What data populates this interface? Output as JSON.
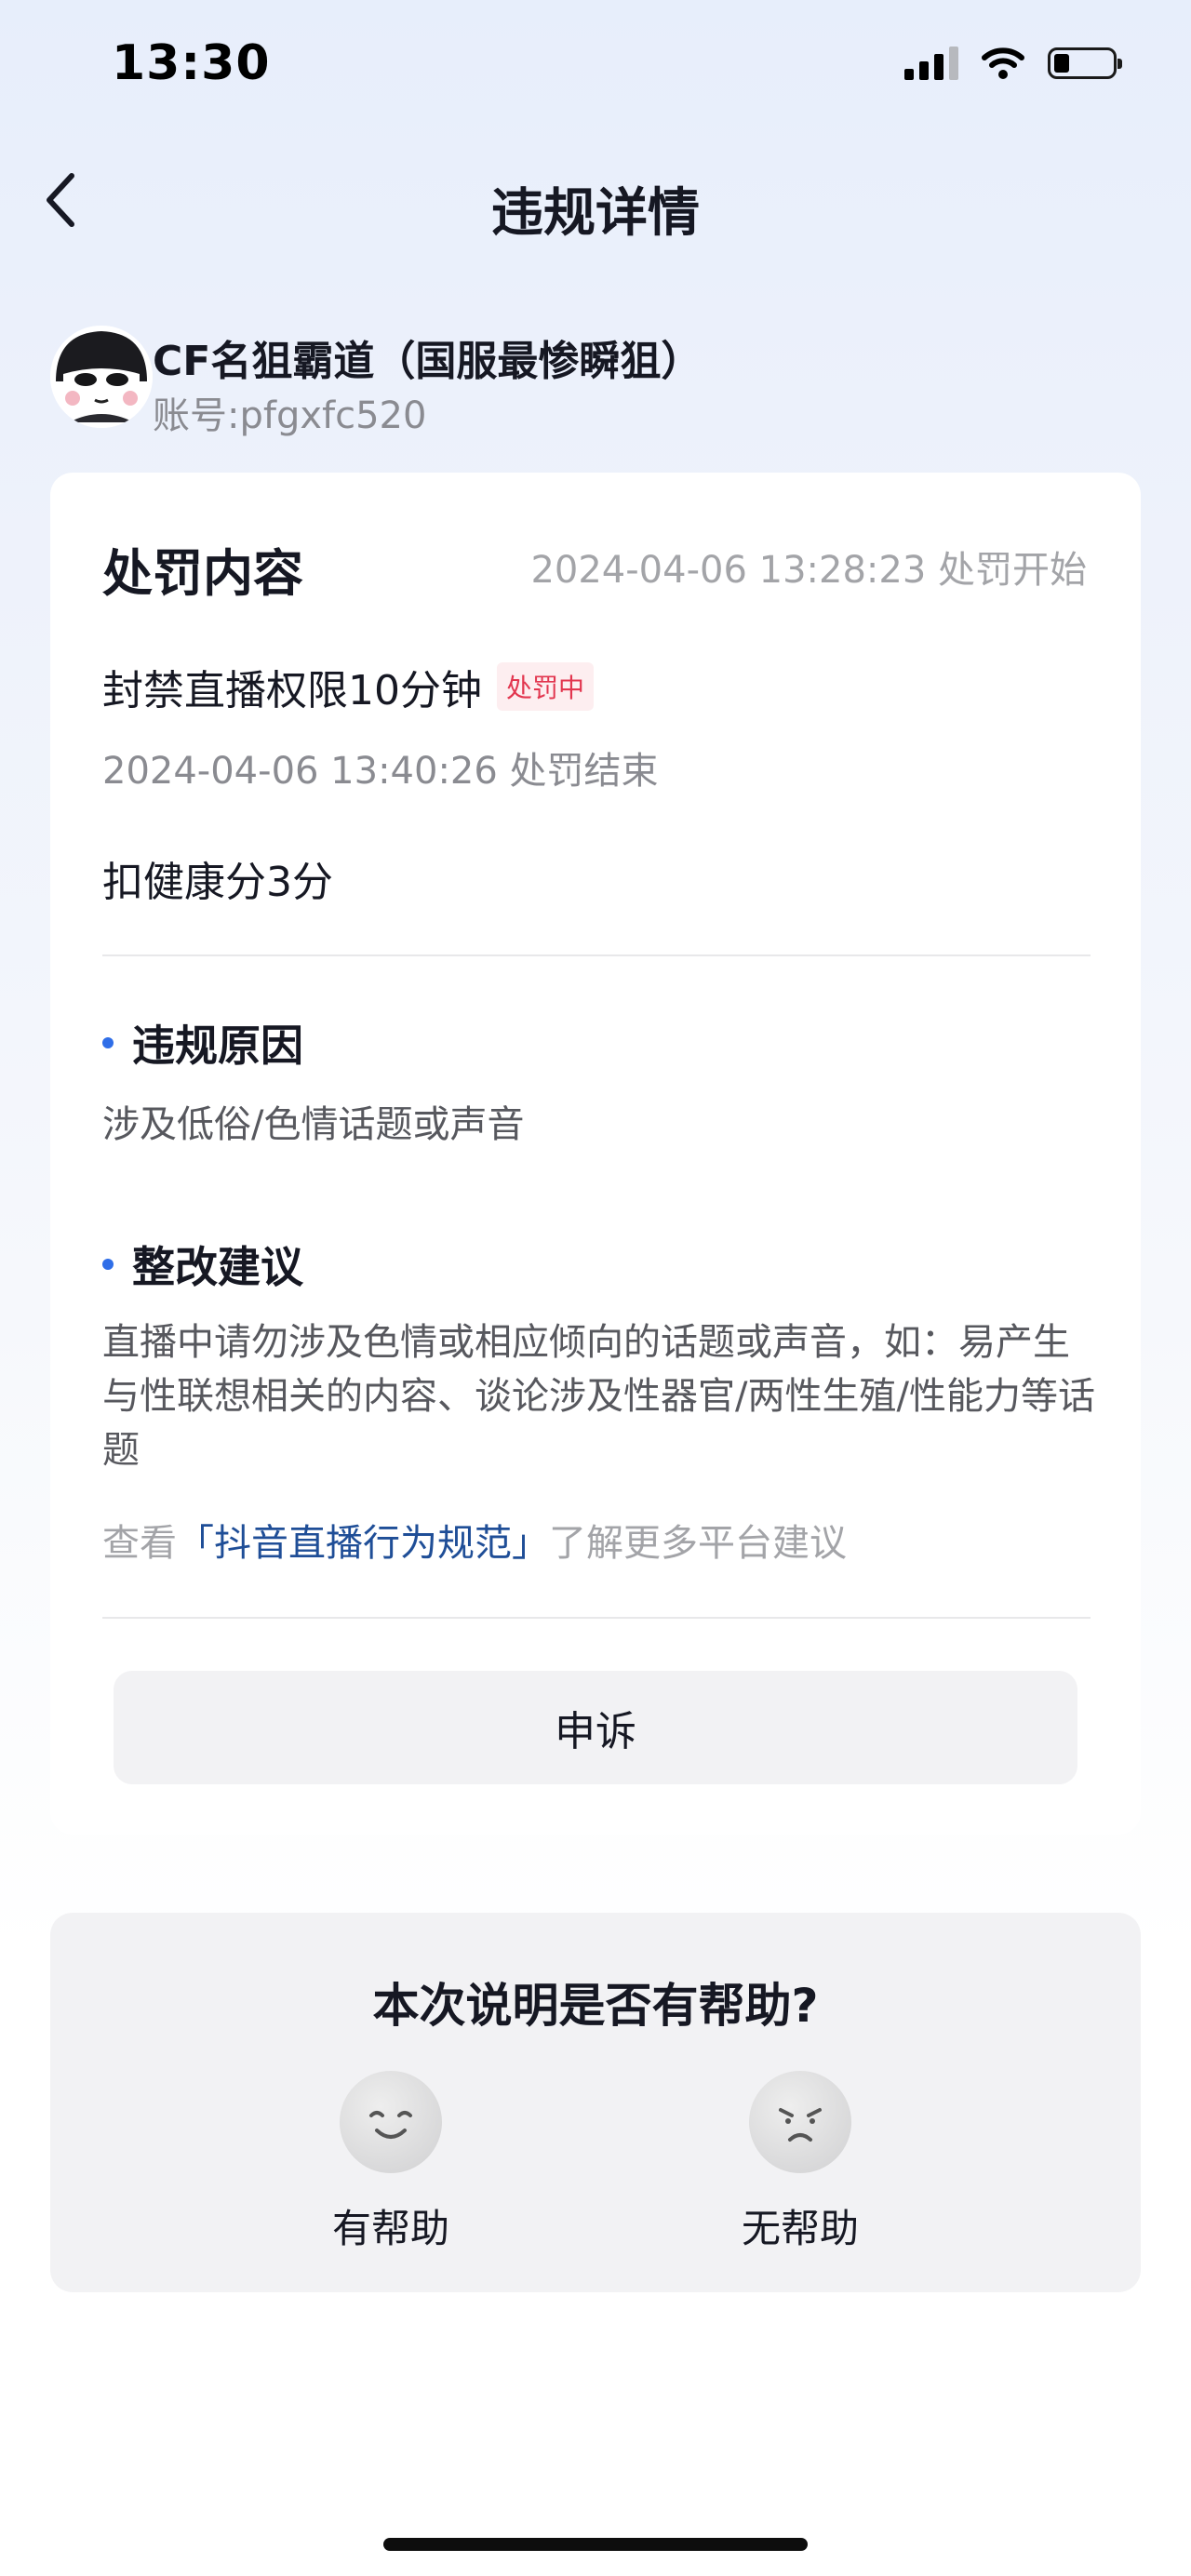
{
  "status_bar": {
    "time": "13:30",
    "icons": [
      "cellular-signal-icon",
      "wifi-icon",
      "battery-icon"
    ]
  },
  "nav": {
    "back_icon": "chevron-left-icon",
    "title": "违规详情"
  },
  "user": {
    "name": "CF名狙霸道（国服最惨瞬狙）",
    "account": "账号:pfgxfc520"
  },
  "penalty": {
    "section_title": "处罚内容",
    "start_time": "2024-04-06 13:28:23 处罚开始",
    "penalty_text": "封禁直播权限10分钟",
    "status_badge": "处罚中",
    "end_time": "2024-04-06 13:40:26 处罚结束",
    "deduction": "扣健康分3分"
  },
  "reason": {
    "title": "违规原因",
    "text": "涉及低俗/色情话题或声音"
  },
  "suggestion": {
    "title": "整改建议",
    "text": "直播中请勿涉及色情或相应倾向的话题或声音，如：易产生与性联想相关的内容、谈论涉及性器官/两性生殖/性能力等话题",
    "rule_prefix": "查看",
    "rule_link": "「抖音直播行为规范」",
    "rule_suffix": "了解更多平台建议"
  },
  "appeal_label": "申诉",
  "feedback": {
    "question": "本次说明是否有帮助?",
    "helpful": "有帮助",
    "not_helpful": "无帮助"
  },
  "colors": {
    "accent_blue": "#2f6ee8",
    "link_blue": "#1f4e97",
    "badge_red": "#e2364f",
    "badge_bg": "#fdeef0"
  }
}
